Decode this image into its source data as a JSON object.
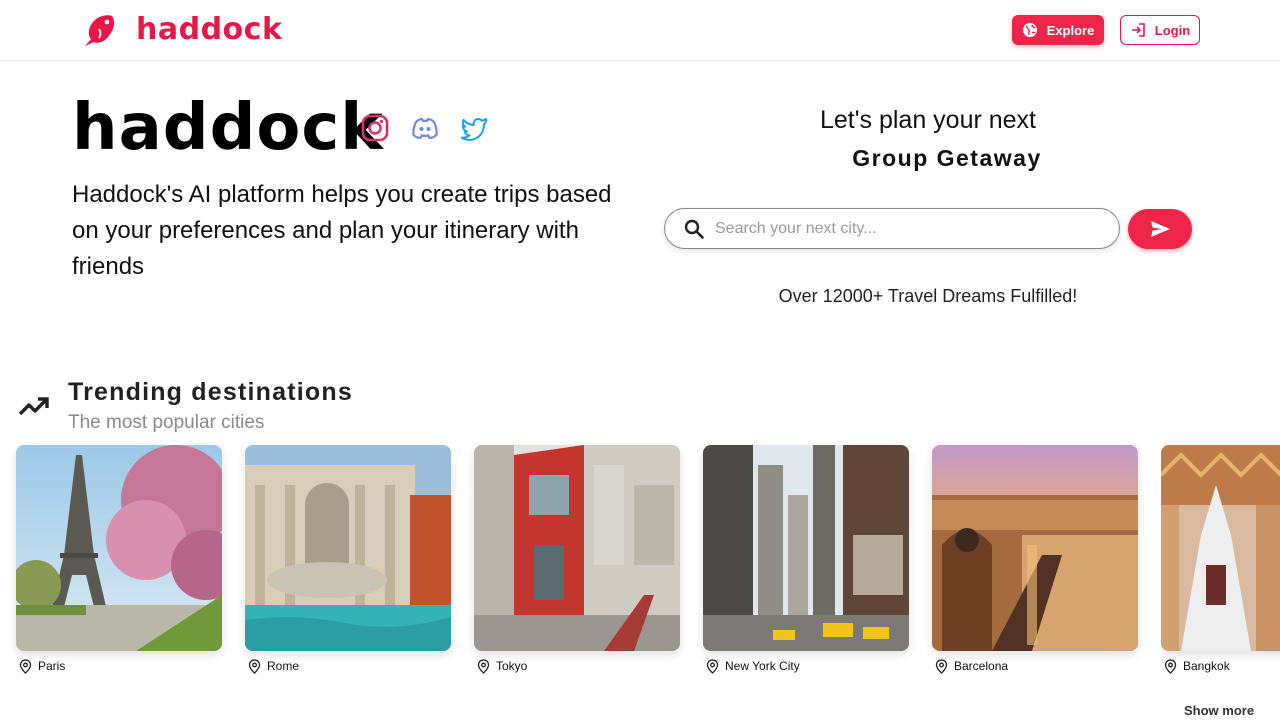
{
  "header": {
    "brand_name": "haddock",
    "explore_label": "Explore",
    "login_label": "Login"
  },
  "hero": {
    "title": "haddock",
    "description": "Haddock's AI platform helps you create trips based on your preferences and plan your itinerary with friends",
    "plan_line1": "Let's plan your next",
    "plan_line2": "Group Getaway",
    "search_placeholder": "Search your next city...",
    "dreams_text": "Over 12000+ Travel Dreams Fulfilled!"
  },
  "trending": {
    "title": "Trending destinations",
    "subtitle": "The most popular cities",
    "cities": [
      {
        "name": "Paris"
      },
      {
        "name": "Rome"
      },
      {
        "name": "Tokyo"
      },
      {
        "name": "New York City"
      },
      {
        "name": "Barcelona"
      },
      {
        "name": "Bangkok"
      }
    ],
    "show_more_label": "Show more"
  },
  "colors": {
    "brand": "#e8174a",
    "accent": "#ee2449",
    "instagram": "#d6336c",
    "discord": "#7289da",
    "twitter": "#1da1f2"
  },
  "icons": {
    "logo": "fish-logo-icon",
    "explore": "globe-icon",
    "login": "login-icon",
    "search": "search-icon",
    "send": "send-icon",
    "trending": "trending-up-icon",
    "location": "location-pin-icon",
    "socials": [
      "instagram-icon",
      "discord-icon",
      "twitter-icon"
    ]
  }
}
